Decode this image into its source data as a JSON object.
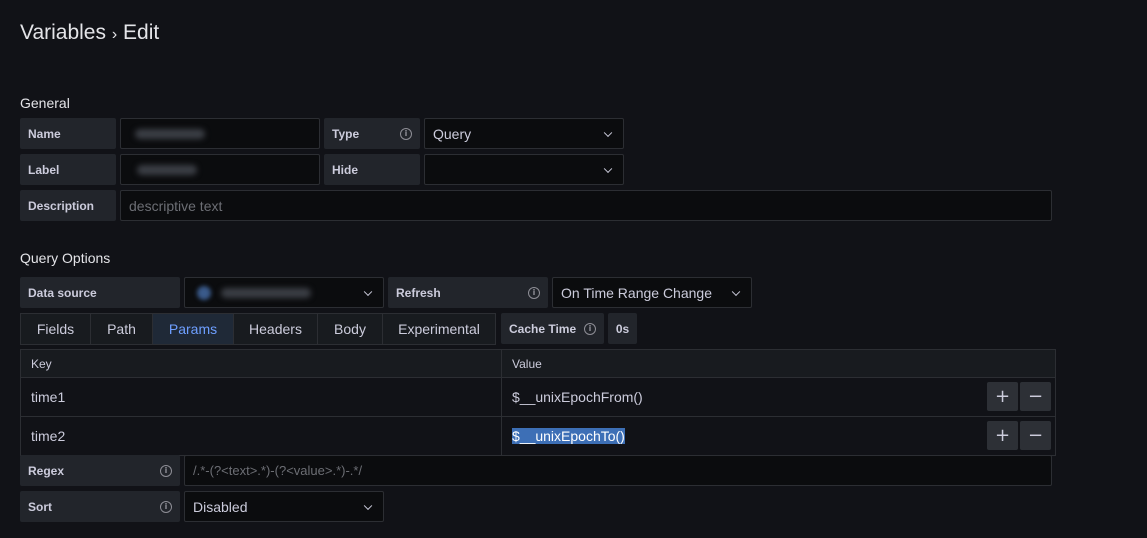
{
  "page": {
    "title": "Variables",
    "separator": "›",
    "subtitle": "Edit"
  },
  "general": {
    "heading": "General",
    "name_label": "Name",
    "type_label": "Type",
    "type_value": "Query",
    "label_label": "Label",
    "hide_label": "Hide",
    "hide_value": "",
    "description_label": "Description",
    "description_placeholder": "descriptive text"
  },
  "query_options": {
    "heading": "Query Options",
    "datasource_label": "Data source",
    "refresh_label": "Refresh",
    "refresh_value": "On Time Range Change",
    "tabs": [
      "Fields",
      "Path",
      "Params",
      "Headers",
      "Body",
      "Experimental"
    ],
    "active_tab": "Params",
    "cache_time_label": "Cache Time",
    "cache_time_value": "0s",
    "table": {
      "headers": [
        "Key",
        "Value"
      ],
      "rows": [
        {
          "key": "time1",
          "value": "$__unixEpochFrom()"
        },
        {
          "key": "time2",
          "value": "$__unixEpochTo()"
        }
      ],
      "add_label": "+",
      "remove_label": "−"
    },
    "regex_label": "Regex",
    "regex_placeholder": "/.*-(?<text>.*)-(?<value>.*)-.*/",
    "sort_label": "Sort",
    "sort_value": "Disabled"
  },
  "icons": {
    "info": "info-icon",
    "chevron": "chevron-down-icon",
    "datasource": "datasource-icon"
  },
  "colors": {
    "background": "#111217",
    "active_tab": "#6e9fff",
    "selection": "#3d6fb6"
  }
}
